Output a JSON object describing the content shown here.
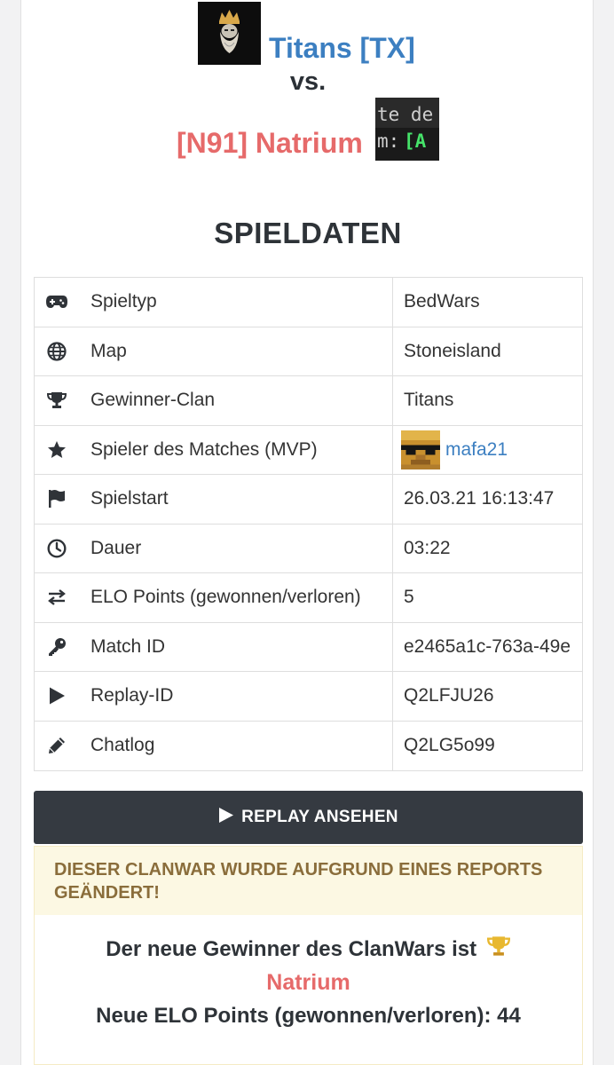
{
  "header": {
    "team1_name": "Titans [TX]",
    "vs": "vs.",
    "team2_name": "[N91] Natrium"
  },
  "section_title": "SPIELDATEN",
  "rows": [
    {
      "icon": "gamepad-icon",
      "label": "Spieltyp",
      "value": "BedWars"
    },
    {
      "icon": "globe-icon",
      "label": "Map",
      "value": "Stoneisland"
    },
    {
      "icon": "trophy-icon",
      "label": "Gewinner-Clan",
      "value": "Titans"
    },
    {
      "icon": "star-icon",
      "label": "Spieler des Matches (MVP)",
      "value": "mafa21"
    },
    {
      "icon": "flag-icon",
      "label": "Spielstart",
      "value": "26.03.21 16:13:47"
    },
    {
      "icon": "clock-icon",
      "label": "Dauer",
      "value": "03:22"
    },
    {
      "icon": "exchange-icon",
      "label": "ELO Points (gewonnen/verloren)",
      "value": "5"
    },
    {
      "icon": "key-icon",
      "label": "Match ID",
      "value": "e2465a1c-763a-49e"
    },
    {
      "icon": "play-icon",
      "label": "Replay-ID",
      "value": "Q2LFJU26"
    },
    {
      "icon": "pencil-icon",
      "label": "Chatlog",
      "value": "Q2LG5o99"
    }
  ],
  "replay_button": "REPLAY ANSEHEN",
  "warning": "DIESER CLANWAR WURDE AUFGRUND EINES REPORTS GEÄNDERT!",
  "result": {
    "line1": "Der neue Gewinner des ClanWars ist",
    "winner": "Natrium",
    "line3": "Neue ELO Points (gewonnen/verloren): 44"
  },
  "colors": {
    "team1": "#3c7fc1",
    "team2": "#e66a6a",
    "chatlog_link": "#e8c23a",
    "button_bg": "#353a41",
    "warning_bg": "#fcf8e3",
    "warning_text": "#8a6d3b"
  }
}
